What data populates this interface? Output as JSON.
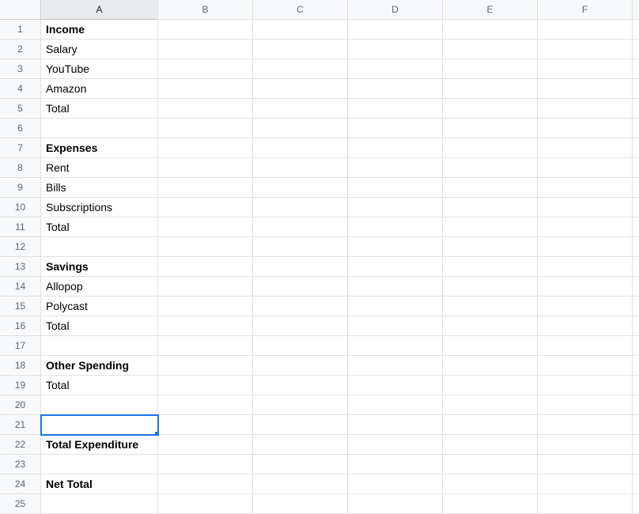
{
  "columns": [
    "A",
    "B",
    "C",
    "D",
    "E",
    "F"
  ],
  "selectedColumn": "A",
  "activeCell": {
    "col": "A",
    "row": 21
  },
  "rows": [
    {
      "n": 1,
      "A": {
        "text": "Income",
        "bold": true
      }
    },
    {
      "n": 2,
      "A": {
        "text": "Salary",
        "bold": false
      }
    },
    {
      "n": 3,
      "A": {
        "text": "YouTube",
        "bold": false
      }
    },
    {
      "n": 4,
      "A": {
        "text": "Amazon",
        "bold": false
      }
    },
    {
      "n": 5,
      "A": {
        "text": "Total",
        "bold": false
      }
    },
    {
      "n": 6,
      "A": {
        "text": "",
        "bold": false
      }
    },
    {
      "n": 7,
      "A": {
        "text": "Expenses",
        "bold": true
      }
    },
    {
      "n": 8,
      "A": {
        "text": "Rent",
        "bold": false
      }
    },
    {
      "n": 9,
      "A": {
        "text": "Bills",
        "bold": false
      }
    },
    {
      "n": 10,
      "A": {
        "text": "Subscriptions",
        "bold": false
      }
    },
    {
      "n": 11,
      "A": {
        "text": "Total",
        "bold": false
      }
    },
    {
      "n": 12,
      "A": {
        "text": "",
        "bold": false
      }
    },
    {
      "n": 13,
      "A": {
        "text": "Savings",
        "bold": true
      }
    },
    {
      "n": 14,
      "A": {
        "text": "Allopop",
        "bold": false
      }
    },
    {
      "n": 15,
      "A": {
        "text": "Polycast",
        "bold": false
      }
    },
    {
      "n": 16,
      "A": {
        "text": "Total",
        "bold": false
      }
    },
    {
      "n": 17,
      "A": {
        "text": "",
        "bold": false
      }
    },
    {
      "n": 18,
      "A": {
        "text": "Other Spending",
        "bold": true
      }
    },
    {
      "n": 19,
      "A": {
        "text": "Total",
        "bold": false
      }
    },
    {
      "n": 20,
      "A": {
        "text": "",
        "bold": false
      }
    },
    {
      "n": 21,
      "A": {
        "text": "",
        "bold": false
      }
    },
    {
      "n": 22,
      "A": {
        "text": "Total Expenditure",
        "bold": true
      }
    },
    {
      "n": 23,
      "A": {
        "text": "",
        "bold": false
      }
    },
    {
      "n": 24,
      "A": {
        "text": "Net Total",
        "bold": true
      }
    },
    {
      "n": 25,
      "A": {
        "text": "",
        "bold": false
      }
    }
  ]
}
